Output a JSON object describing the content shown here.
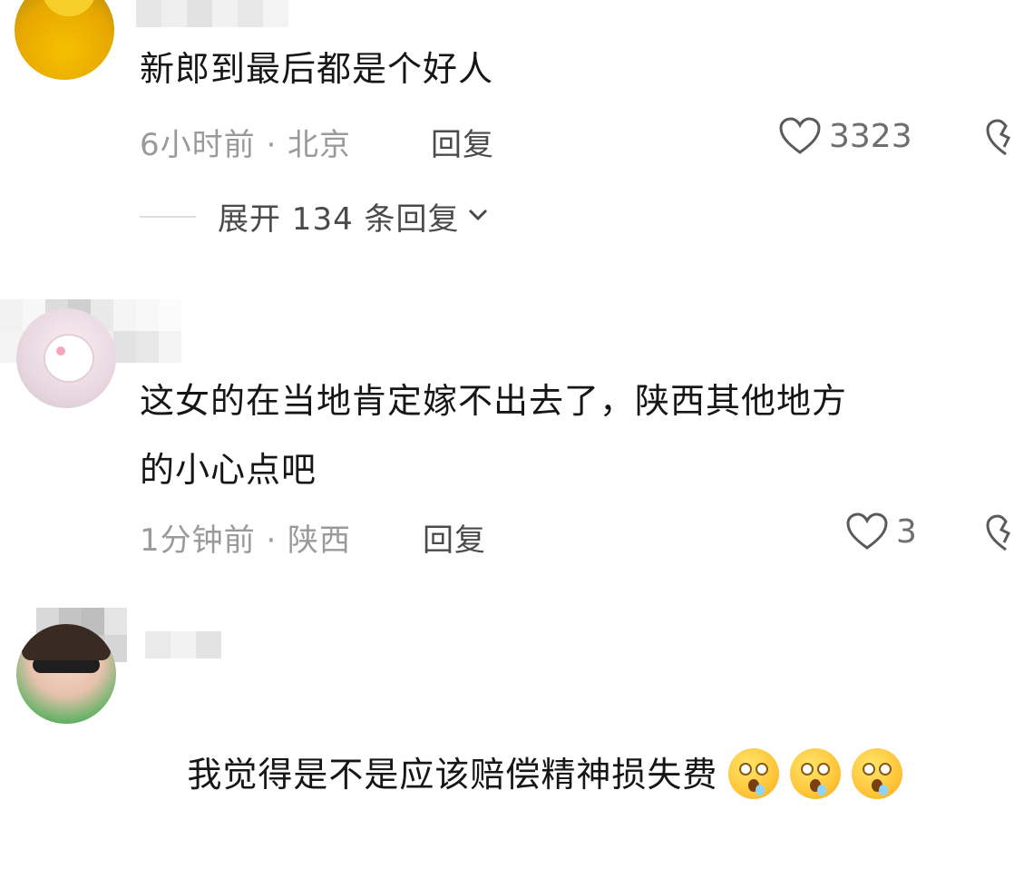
{
  "comments": [
    {
      "text": "新郎到最后都是个好人",
      "time": "6小时前 · 北京",
      "reply_label": "回复",
      "likes": "3323",
      "expand_label": "展开 134 条回复"
    },
    {
      "text": "这女的在当地肯定嫁不出去了，陕西其他地方\n的小心点吧",
      "time": "1分钟前 · 陕西",
      "reply_label": "回复",
      "likes": "3"
    },
    {
      "text": "我觉得是不是应该赔偿精神损失费",
      "emoji_count": 3,
      "emoji_icon": "dizzy-face-emoji"
    }
  ],
  "colors": {
    "text": "#161616",
    "meta": "#9a9a9a",
    "reply": "#4b4b4b",
    "like": "#6e6e6e"
  }
}
